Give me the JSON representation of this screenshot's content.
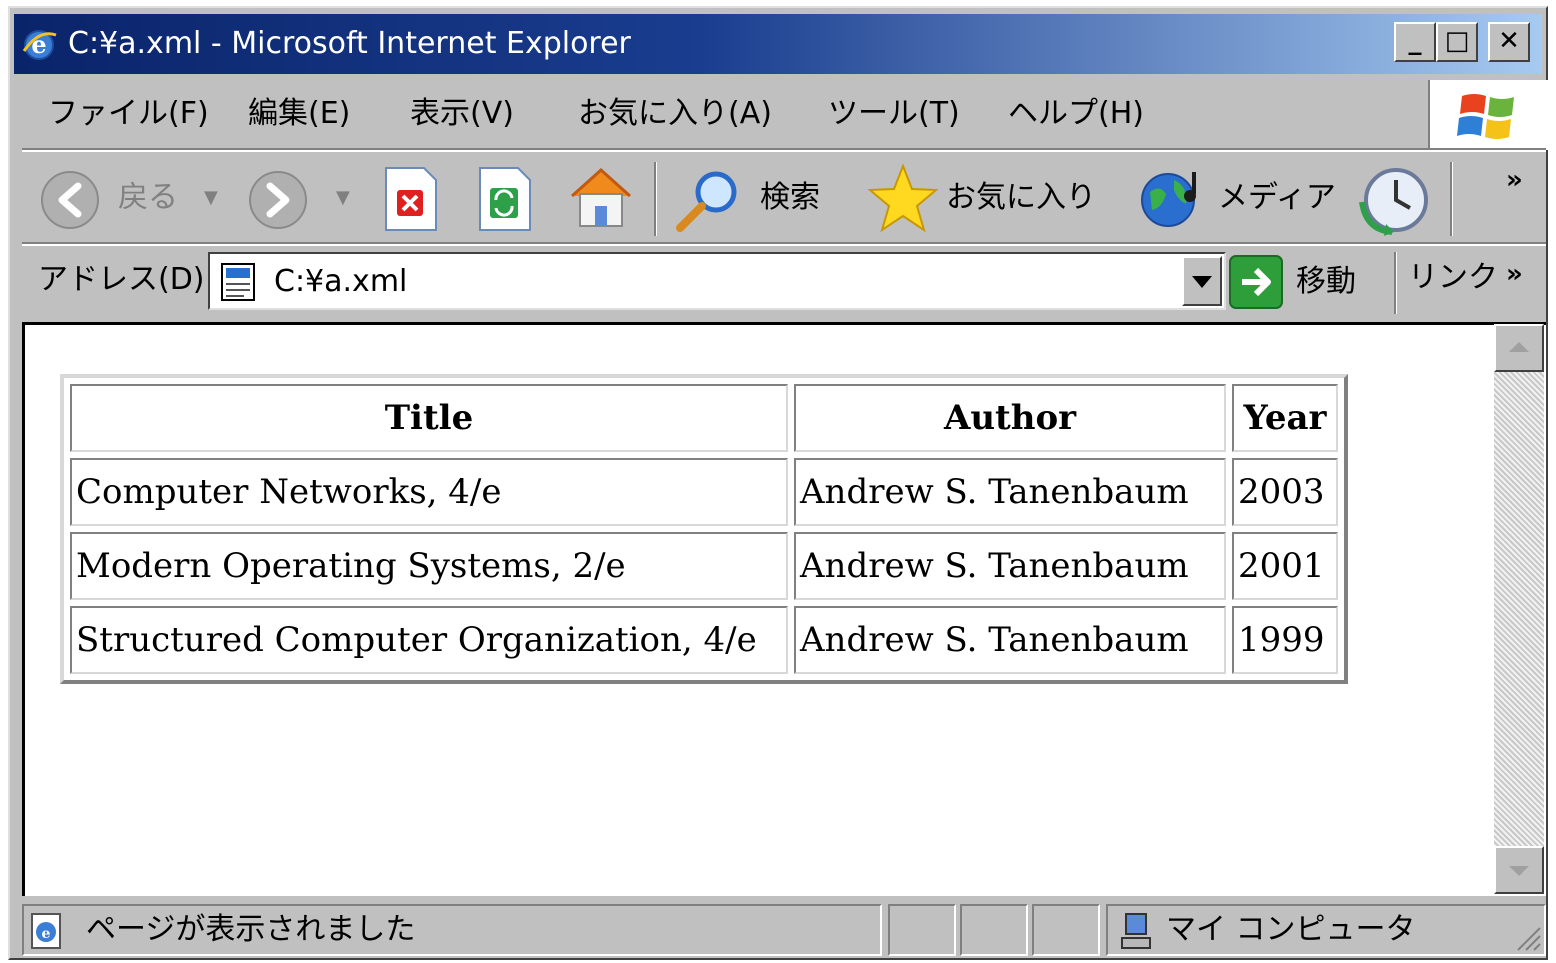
{
  "window": {
    "title": "C:¥a.xml - Microsoft Internet Explorer",
    "controls": {
      "minimize": "_",
      "maximize": "□",
      "close": "✕"
    }
  },
  "menu": [
    "ファイル(F)",
    "編集(E)",
    "表示(V)",
    "お気に入り(A)",
    "ツール(T)",
    "ヘルプ(H)"
  ],
  "toolbar": {
    "back_label": "戻る",
    "search_label": "検索",
    "favorites_label": "お気に入り",
    "media_label": "メディア",
    "more": "»"
  },
  "address": {
    "label": "アドレス(D)",
    "value": "C:¥a.xml",
    "go_label": "移動",
    "links_label": "リンク",
    "more": "»"
  },
  "table": {
    "headers": [
      "Title",
      "Author",
      "Year"
    ],
    "rows": [
      [
        "Computer Networks, 4/e",
        "Andrew S. Tanenbaum",
        "2003"
      ],
      [
        "Modern Operating Systems, 2/e",
        "Andrew S. Tanenbaum",
        "2001"
      ],
      [
        "Structured Computer Organization, 4/e",
        "Andrew S. Tanenbaum",
        "1999"
      ]
    ]
  },
  "status": {
    "message": "ページが表示されました",
    "zone": "マイ コンピュータ"
  },
  "colors": {
    "titlebar_start": "#0a246a",
    "titlebar_end": "#a6caf0",
    "chrome": "#c0c0c0",
    "go_green": "#2e9e3a"
  },
  "icons": [
    "ie-icon",
    "windows-logo-icon",
    "back-arrow-icon",
    "forward-arrow-icon",
    "stop-icon",
    "refresh-icon",
    "home-icon",
    "search-magnifier-icon",
    "favorites-star-icon",
    "media-globe-icon",
    "history-clock-icon",
    "page-icon",
    "go-arrow-icon",
    "computer-icon"
  ]
}
